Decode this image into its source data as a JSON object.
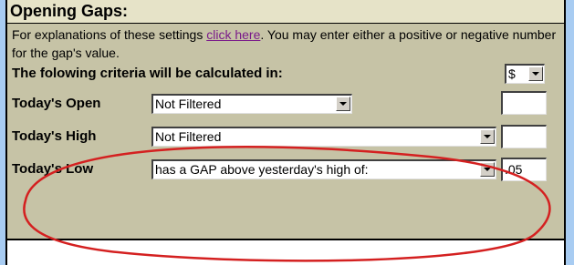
{
  "panel": {
    "title": "Opening Gaps:",
    "explain_prefix": "For explanations of these settings ",
    "explain_link": "click here",
    "explain_suffix": ". You may enter either a positive or negative number for the gap's value."
  },
  "criteria": {
    "label": "The folowing criteria will be calculated in:",
    "unit_value": "$"
  },
  "rows": [
    {
      "label": "Today's Open",
      "select_value": "Not Filtered",
      "input_value": ""
    },
    {
      "label": "Today's High",
      "select_value": "Not Filtered",
      "input_value": ""
    },
    {
      "label": "Today's Low",
      "select_value": "has a GAP above yesterday's high of:",
      "input_value": ".05"
    }
  ],
  "colors": {
    "panel_bg": "#c6c3a6",
    "header_bg": "#e6e3c8",
    "page_bg": "#a8ccf2",
    "annotation": "#d42020"
  },
  "annotation": {
    "shape": "ellipse",
    "target": "Today's Low row"
  }
}
